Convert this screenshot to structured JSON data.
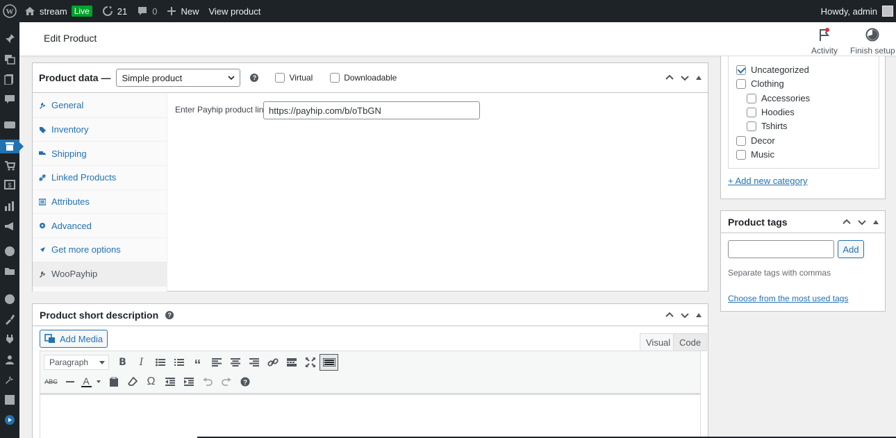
{
  "adminbar": {
    "site_name": "stream",
    "live_badge": "Live",
    "updates_count": "21",
    "comments_count": "0",
    "new_label": "New",
    "view_product": "View product",
    "howdy": "Howdy, admin"
  },
  "header": {
    "title": "Edit Product",
    "activity_label": "Activity",
    "finish_setup_label": "Finish setup"
  },
  "product_data": {
    "title": "Product data —",
    "product_type": "Simple product",
    "virtual_label": "Virtual",
    "downloadable_label": "Downloadable",
    "tabs": [
      {
        "label": "General"
      },
      {
        "label": "Inventory"
      },
      {
        "label": "Shipping"
      },
      {
        "label": "Linked Products"
      },
      {
        "label": "Attributes"
      },
      {
        "label": "Advanced"
      },
      {
        "label": "Get more options"
      },
      {
        "label": "WooPayhip"
      }
    ],
    "field_label": "Enter Payhip product link",
    "field_value": "https://payhip.com/b/oTbGN"
  },
  "short_description": {
    "title": "Product short description",
    "add_media": "Add Media",
    "tab_visual": "Visual",
    "tab_code": "Code",
    "format_select": "Paragraph"
  },
  "categories": {
    "items": [
      {
        "label": "Uncategorized",
        "checked": true
      },
      {
        "label": "Clothing",
        "checked": false
      },
      {
        "label": "Accessories",
        "checked": false
      },
      {
        "label": "Hoodies",
        "checked": false
      },
      {
        "label": "Tshirts",
        "checked": false
      },
      {
        "label": "Decor",
        "checked": false
      },
      {
        "label": "Music",
        "checked": false
      }
    ],
    "add_new": "+ Add new category"
  },
  "tags": {
    "title": "Product tags",
    "input_value": "",
    "add_button": "Add",
    "help": "Separate tags with commas",
    "most_used_link": "Choose from the most used tags"
  },
  "colors": {
    "admin_bar": "#1d2327",
    "accent": "#2271b1",
    "live": "#00a32a"
  }
}
